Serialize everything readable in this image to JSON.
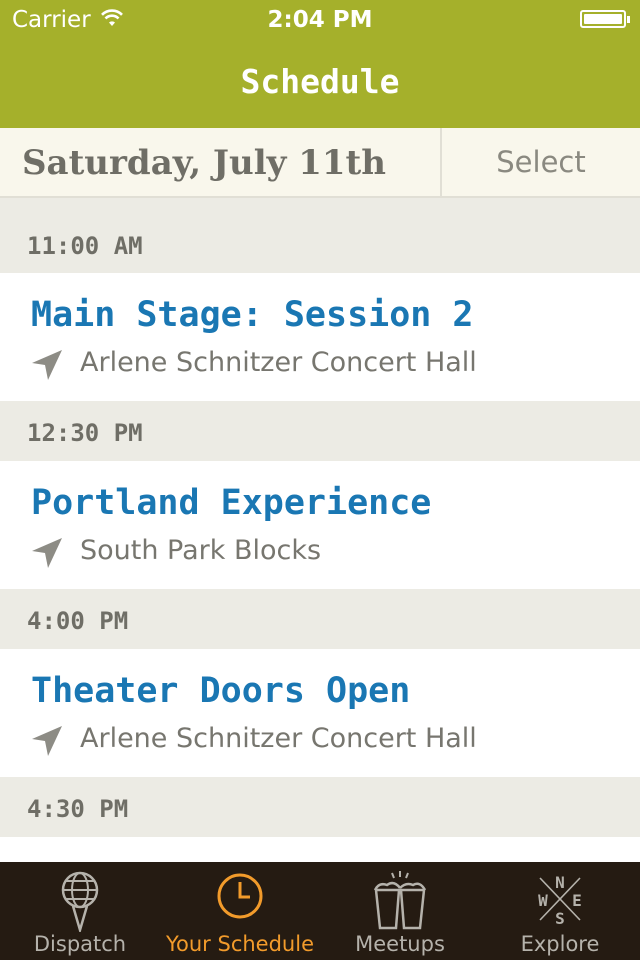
{
  "status_bar": {
    "carrier": "Carrier",
    "time": "2:04 PM"
  },
  "nav": {
    "title": "Schedule"
  },
  "date_bar": {
    "date": "Saturday, July 11th",
    "select_label": "Select"
  },
  "schedule": [
    {
      "time": "11:00 AM",
      "title": "Main Stage: Session 2",
      "venue": "Arlene Schnitzer Concert Hall"
    },
    {
      "time": "12:30 PM",
      "title": "Portland Experience",
      "venue": "South Park Blocks"
    },
    {
      "time": "4:00 PM",
      "title": "Theater Doors Open",
      "venue": "Arlene Schnitzer Concert Hall"
    },
    {
      "time": "4:30 PM"
    }
  ],
  "tabs": [
    {
      "label": "Dispatch",
      "icon": "globe-pin-icon"
    },
    {
      "label": "Your Schedule",
      "icon": "clock-icon",
      "active": true
    },
    {
      "label": "Meetups",
      "icon": "cups-icon"
    },
    {
      "label": "Explore",
      "icon": "compass-icon"
    }
  ],
  "colors": {
    "header": "#a5b02b",
    "event_title": "#1a77b3",
    "tab_active": "#f29b2b",
    "tabbar": "#251b12"
  }
}
